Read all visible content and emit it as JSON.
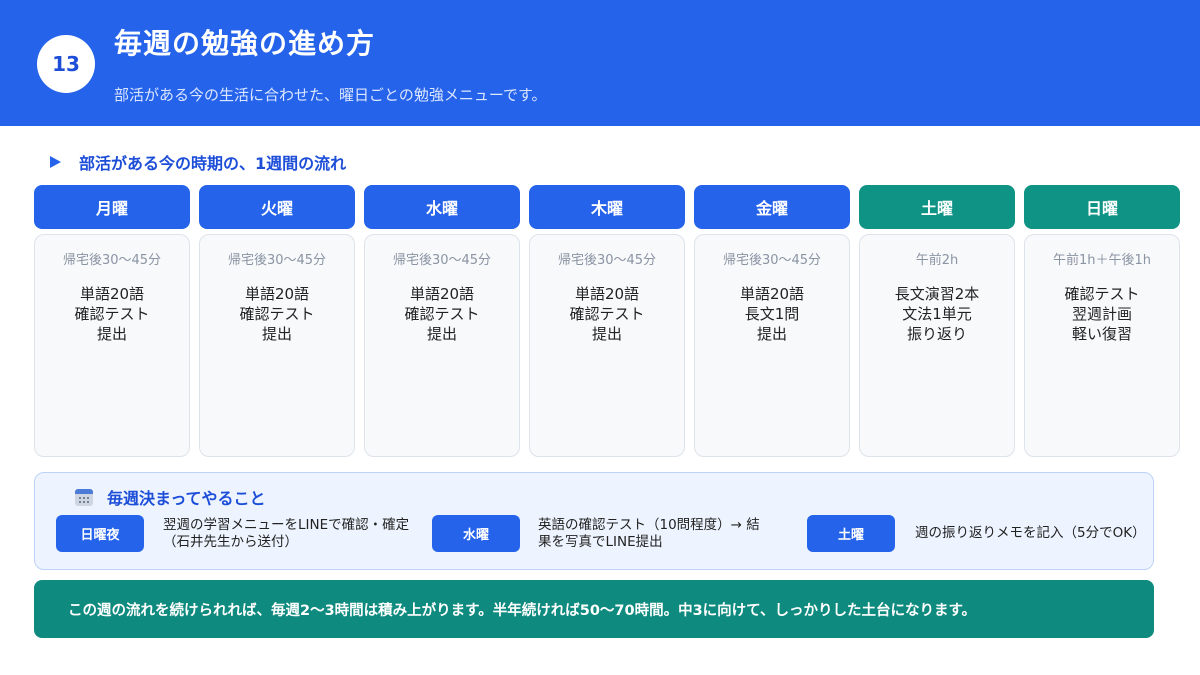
{
  "header": {
    "number": "13",
    "title": "毎週の勉強の進め方",
    "subtitle": "部活がある今の生活に合わせた、曜日ごとの勉強メニューです。"
  },
  "section": {
    "icon": "triangle-right-icon",
    "title": "部活がある今の時期の、1週間の流れ"
  },
  "days": [
    {
      "name": "月曜",
      "time": "帰宅後30〜45分",
      "items": [
        "単語20語",
        "確認テスト",
        "提出"
      ],
      "color": "#2563eb"
    },
    {
      "name": "火曜",
      "time": "帰宅後30〜45分",
      "items": [
        "単語20語",
        "確認テスト",
        "提出"
      ],
      "color": "#2563eb"
    },
    {
      "name": "水曜",
      "time": "帰宅後30〜45分",
      "items": [
        "単語20語",
        "確認テスト",
        "提出"
      ],
      "color": "#2563eb"
    },
    {
      "name": "木曜",
      "time": "帰宅後30〜45分",
      "items": [
        "単語20語",
        "確認テスト",
        "提出"
      ],
      "color": "#2563eb"
    },
    {
      "name": "金曜",
      "time": "帰宅後30〜45分",
      "items": [
        "単語20語",
        "長文1問",
        "提出"
      ],
      "color": "#2563eb"
    },
    {
      "name": "土曜",
      "time": "午前2h",
      "items": [
        "長文演習2本",
        "文法1単元",
        "振り返り"
      ],
      "color": "#0e9384"
    },
    {
      "name": "日曜",
      "time": "午前1h＋午後1h",
      "items": [
        "確認テスト",
        "翌週計画",
        "軽い復習"
      ],
      "color": "#0e9384"
    }
  ],
  "weekly": {
    "icon": "calendar-icon",
    "title": "毎週決まってやること",
    "entries": [
      {
        "tag": "日曜夜",
        "line1": "翌週の学習メニューをLINEで確認・確定",
        "line2": "（石井先生から送付）"
      },
      {
        "tag": "水曜",
        "line1": "英語の確認テスト（10問程度）→ 結",
        "line2": "果を写真でLINE提出"
      },
      {
        "tag": "土曜",
        "line1": "週の振り返りメモを記入（5分でOK）",
        "line2": ""
      }
    ]
  },
  "footer": {
    "text": "この週の流れを続けられれば、毎週2〜3時間は積み上がります。半年続ければ50〜70時間。中3に向けて、しっかりした土台になります。"
  },
  "colors": {
    "primary": "#2563eb",
    "teal": "#0e9384",
    "footer": "#0e8a7e"
  }
}
